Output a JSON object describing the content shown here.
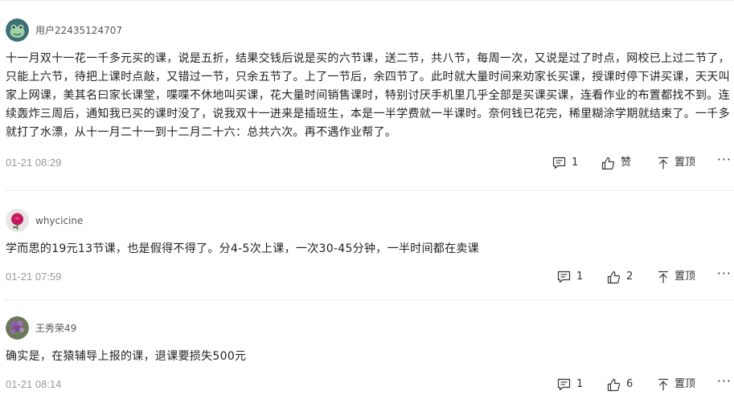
{
  "comments": [
    {
      "username": "用户22435124707",
      "text": "十一月双十一花一千多元买的课，说是五折，结果交钱后说是买的六节课，送二节，共八节，每周一次，又说是过了时点，网校已上过二节了，只能上六节，待把上课时点敲，又错过一节，只余五节了。上了一节后，余四节了。此时就大量时间来劝家长买课，授课时停下讲买课，天天叫家上网课，美其名曰家长课堂，喋喋不休地叫买课，花大量时间销售课时，特别讨厌手机里几乎全部是买课买课，连看作业的布置都找不到。连续轰炸三周后，通知我已买的课时没了，说我双十一进来是插班生，本是一半学费就一半课时。奈何钱已花完，稀里糊涂学期就结束了。一千多就打了水漂，从十一月二十一到十二月二十六：总共六次。再不遇作业帮了。",
      "time": "01-21 08:29",
      "reply_count": "1",
      "like_label": "赞",
      "pin_label": "置顶",
      "more": "···"
    },
    {
      "username": "whycicine",
      "text": "学而思的19元13节课，也是假得不得了。分4-5次上课，一次30-45分钟，一半时间都在卖课",
      "time": "01-21 07:59",
      "reply_count": "1",
      "like_label": "2",
      "pin_label": "置顶",
      "more": "···"
    },
    {
      "username": "王秀荣49",
      "text": "确实是，在猿辅导上报的课，退课要损失500元",
      "time": "01-21 08:14",
      "reply_count": "1",
      "like_label": "6",
      "pin_label": "置顶",
      "more": "···"
    }
  ],
  "icons": {
    "reply": "comment-bubble-icon",
    "like": "thumbs-up-icon",
    "pin": "pin-top-icon",
    "avatar_1": "frog-avatar",
    "avatar_2": "rose-avatar",
    "avatar_3": "flower-avatar"
  }
}
